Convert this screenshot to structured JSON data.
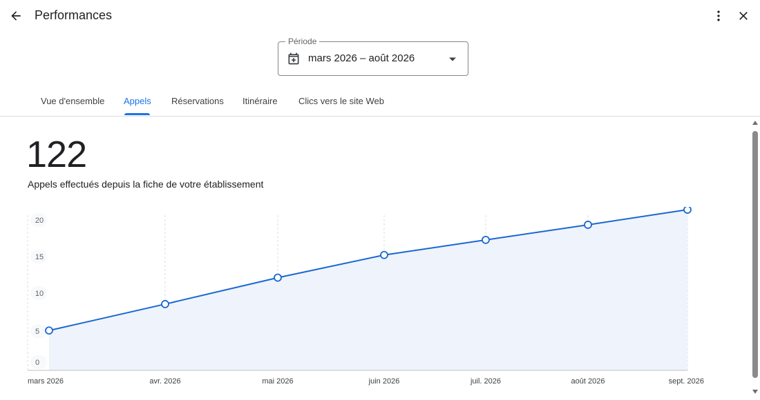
{
  "header": {
    "title": "Performances",
    "back_icon": "arrow-back-icon",
    "more_icon": "more-vert-icon",
    "close_icon": "close-icon"
  },
  "period": {
    "label": "Période",
    "value": "mars 2026 – août 2026",
    "icon": "calendar-icon"
  },
  "tabs": [
    {
      "label": "Vue d'ensemble",
      "active": false
    },
    {
      "label": "Appels",
      "active": true
    },
    {
      "label": "Réservations",
      "active": false
    },
    {
      "label": "Itinéraire",
      "active": false
    },
    {
      "label": "Clics vers le site Web",
      "active": false
    }
  ],
  "summary": {
    "total": "122",
    "description": "Appels effectués depuis la fiche de votre établissement"
  },
  "colors": {
    "accent": "#1a73e8",
    "line": "#1967d2",
    "area": "#eef3fc"
  },
  "chart_data": {
    "type": "area",
    "x": [
      "mars 2026",
      "avr. 2026",
      "mai 2026",
      "juin 2026",
      "juil. 2026",
      "août 2026",
      "sept. 2026"
    ],
    "y_ticks": [
      0,
      5,
      10,
      15,
      20
    ],
    "ylim": [
      0,
      20
    ],
    "series": [
      {
        "values": [
          5,
          8.5,
          12,
          15,
          17,
          19,
          21
        ]
      }
    ],
    "grid": true
  }
}
